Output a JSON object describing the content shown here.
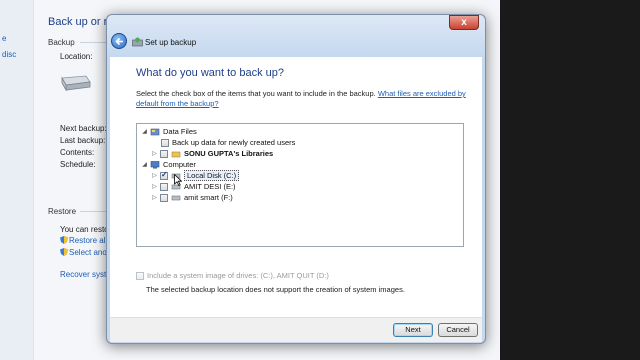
{
  "background_window": {
    "left_link": "e",
    "left_link_2": "disc",
    "title": "Back up or restore your files",
    "backup_section": "Backup",
    "location_label": "Location:",
    "next_backup_label": "Next backup:",
    "last_backup_label": "Last backup:",
    "contents_label": "Contents:",
    "schedule_label": "Schedule:",
    "restore_section": "Restore",
    "you_can_restore": "You can restore",
    "restore_all_link": "Restore all",
    "select_another_link": "Select anoth",
    "recover_system_link": "Recover system"
  },
  "dialog": {
    "caption": "Set up backup",
    "close_label": "x",
    "heading": "What do you want to back up?",
    "instructions": "Select the check box of the items that you want to include in the backup.",
    "instructions_link": "What files are excluded by default from the backup?",
    "tree": {
      "data_files": "Data Files",
      "new_users": "Back up data for newly created users",
      "libraries": "SONU GUPTA's Libraries",
      "computer": "Computer",
      "drive_c": "Local Disk (C:)",
      "drive_e": "AMIT DESI (E:)",
      "drive_f": "amit smart (F:)"
    },
    "system_image_option": "Include a system image of drives: (C:), AMIT QUIT (D:)",
    "system_image_note": "The selected backup location does not support the creation of system images.",
    "next_button": "Next",
    "cancel_button": "Cancel"
  }
}
